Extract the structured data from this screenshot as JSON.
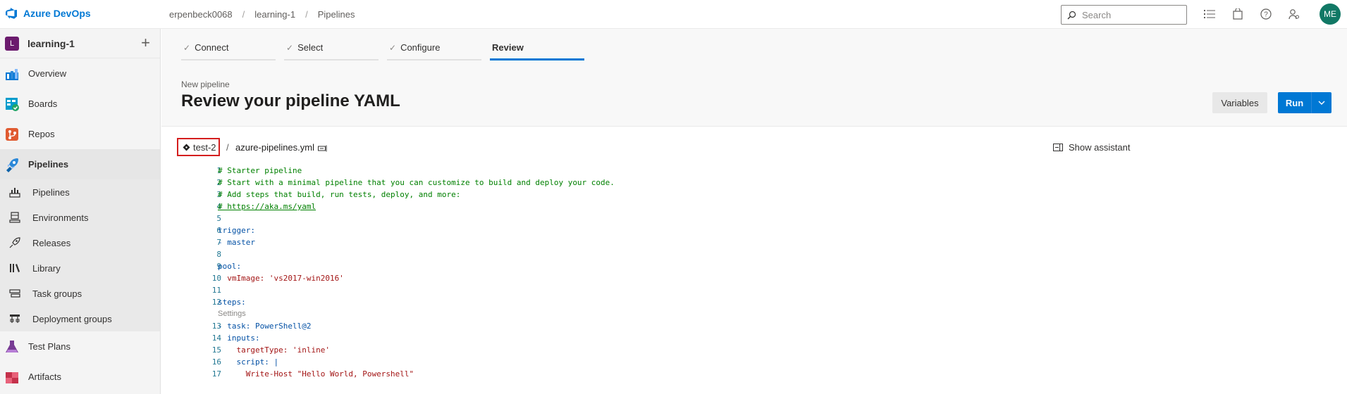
{
  "app": {
    "name": "Azure DevOps"
  },
  "breadcrumb": [
    "erpenbeck0068",
    "learning-1",
    "Pipelines"
  ],
  "search": {
    "placeholder": "Search"
  },
  "user": {
    "initials": "ME"
  },
  "project": {
    "initial": "L",
    "name": "learning-1"
  },
  "sidebar": {
    "items": [
      {
        "label": "Overview",
        "icon": "overview-icon"
      },
      {
        "label": "Boards",
        "icon": "boards-icon"
      },
      {
        "label": "Repos",
        "icon": "repos-icon"
      },
      {
        "label": "Pipelines",
        "icon": "pipelines-icon"
      },
      {
        "label": "Pipelines",
        "icon": "pipeline-sub-icon"
      },
      {
        "label": "Environments",
        "icon": "environments-icon"
      },
      {
        "label": "Releases",
        "icon": "releases-icon"
      },
      {
        "label": "Library",
        "icon": "library-icon"
      },
      {
        "label": "Task groups",
        "icon": "task-groups-icon"
      },
      {
        "label": "Deployment groups",
        "icon": "deployment-groups-icon"
      },
      {
        "label": "Test Plans",
        "icon": "test-plans-icon"
      },
      {
        "label": "Artifacts",
        "icon": "artifacts-icon"
      }
    ]
  },
  "wizard": {
    "steps": [
      "Connect",
      "Select",
      "Configure",
      "Review"
    ]
  },
  "page": {
    "subtitle": "New pipeline",
    "title": "Review your pipeline YAML",
    "variables_label": "Variables",
    "run_label": "Run"
  },
  "file": {
    "branch": "test-2",
    "separator": "/",
    "name": "azure-pipelines.yml",
    "assistant_label": "Show assistant"
  },
  "editor": {
    "settings_lens": "Settings",
    "lines": [
      {
        "n": "1",
        "text": "# Starter pipeline"
      },
      {
        "n": "2",
        "text": "# Start with a minimal pipeline that you can customize to build and deploy your code."
      },
      {
        "n": "3",
        "text": "# Add steps that build, run tests, deploy, and more:"
      },
      {
        "n": "4",
        "text": "# https://aka.ms/yaml"
      },
      {
        "n": "5",
        "text": ""
      },
      {
        "n": "6",
        "text": "trigger:"
      },
      {
        "n": "7",
        "text": "- master"
      },
      {
        "n": "8",
        "text": ""
      },
      {
        "n": "9",
        "text": "pool:"
      },
      {
        "n": "10",
        "text": "  vmImage: 'vs2017-win2016'"
      },
      {
        "n": "11",
        "text": ""
      },
      {
        "n": "12",
        "text": "steps:"
      },
      {
        "n": "13",
        "text": "- task: PowerShell@2"
      },
      {
        "n": "14",
        "text": "  inputs:"
      },
      {
        "n": "15",
        "text": "    targetType: 'inline'"
      },
      {
        "n": "16",
        "text": "    script: |"
      },
      {
        "n": "17",
        "text": "      Write-Host \"Hello World, Powershell\""
      }
    ]
  },
  "colors": {
    "accent": "#0078d4",
    "avatar_bg": "#117865",
    "project_badge": "#6b1a6d",
    "highlight_box": "#d41e1e"
  }
}
